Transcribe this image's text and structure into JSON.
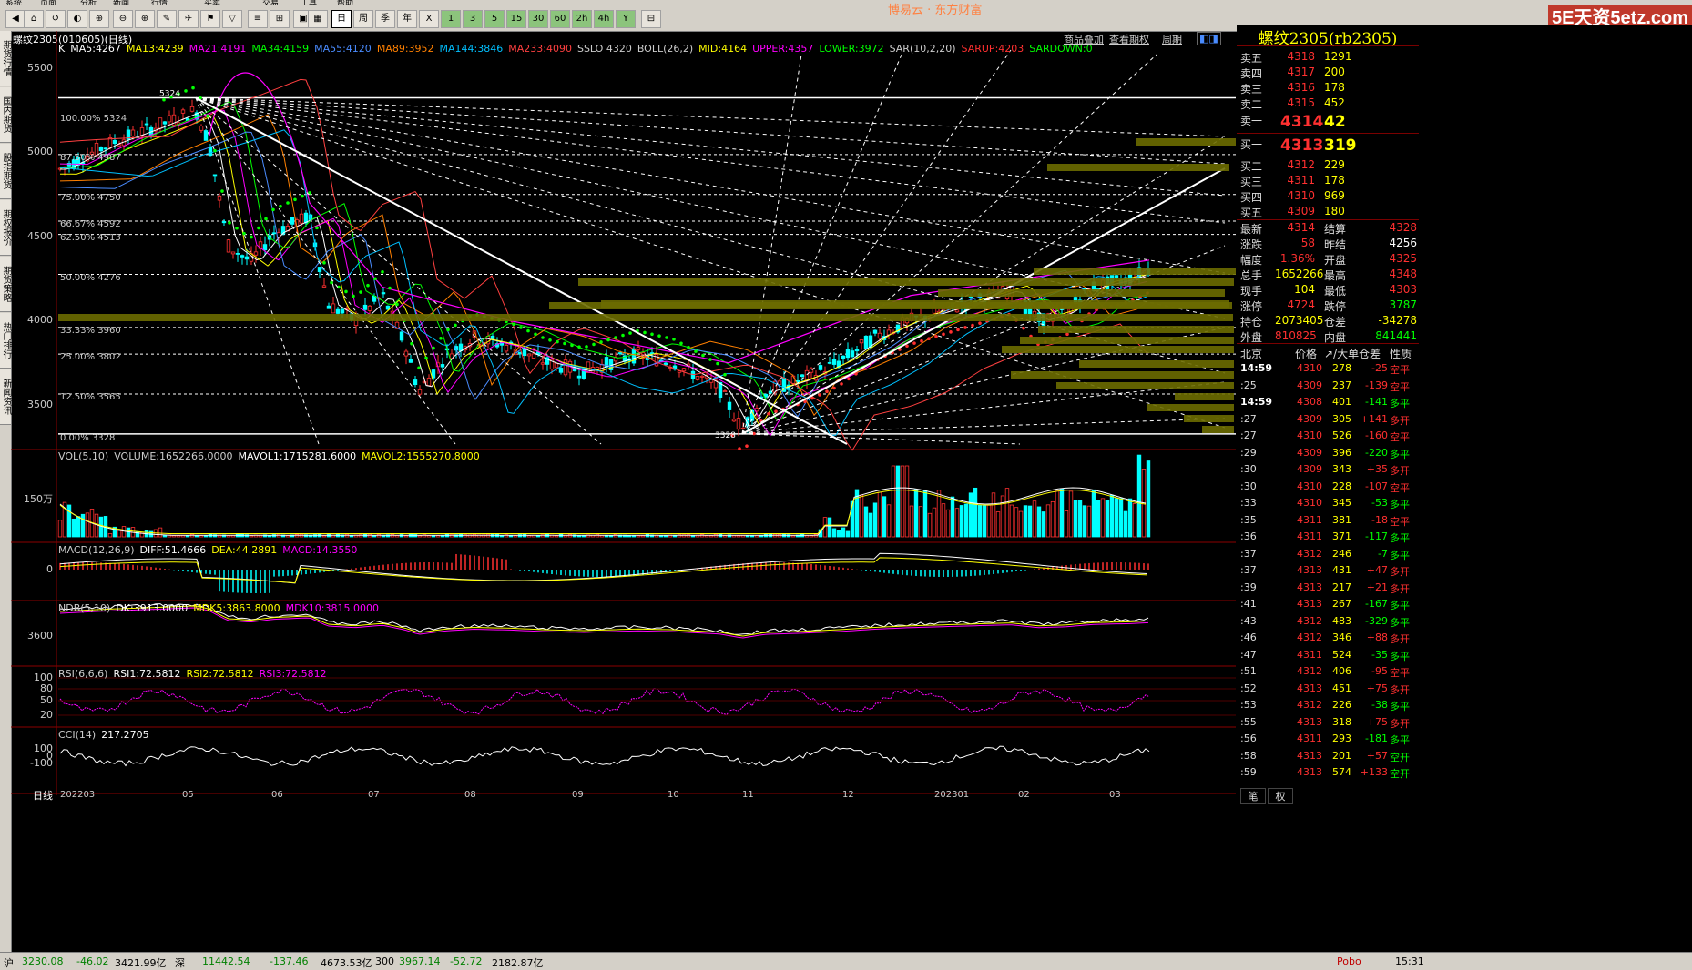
{
  "menu": [
    "系统",
    "页面",
    "分析",
    "新闻",
    "行情",
    "买卖",
    "交易",
    "工具",
    "帮助"
  ],
  "window_title": "博易云 · 东方财富",
  "brand_logo": "5E天资5etz.com",
  "left_tabs": [
    "期货行情",
    "国内期货",
    "股指期货",
    "期权报价",
    "期货策略",
    "热门排行",
    "新闻资讯"
  ],
  "toolbar_labels": {
    "day_k": "日",
    "week": "周",
    "month": "季",
    "year": "年"
  },
  "chart": {
    "symbol": "螺纹2305(010605)(日线)",
    "links": [
      "商品叠加",
      "查看期权",
      "周期"
    ],
    "ma_legend": [
      {
        "t": "K",
        "c": "#ffffff"
      },
      {
        "t": "MA5:4267",
        "c": "#ffffff"
      },
      {
        "t": "MA13:4239",
        "c": "#ffff00"
      },
      {
        "t": "MA21:4191",
        "c": "#ff00ff"
      },
      {
        "t": "MA34:4159",
        "c": "#00ff00"
      },
      {
        "t": "MA55:4120",
        "c": "#4a8cff"
      },
      {
        "t": "MA89:3952",
        "c": "#ff8000"
      },
      {
        "t": "MA144:3846",
        "c": "#00c0ff"
      },
      {
        "t": "MA233:4090",
        "c": "#ff4040"
      },
      {
        "t": "SSLO 4320",
        "c": "#cccccc"
      },
      {
        "t": "BOLL(26,2)",
        "c": "#cccccc"
      },
      {
        "t": "MID:4164",
        "c": "#ffff00"
      },
      {
        "t": "UPPER:4357",
        "c": "#ff00ff"
      },
      {
        "t": "LOWER:3972",
        "c": "#00ff00"
      },
      {
        "t": "SAR(10,2,20)",
        "c": "#cccccc"
      },
      {
        "t": "SARUP:4203",
        "c": "#ff3030"
      },
      {
        "t": "SARDOWN:0",
        "c": "#00ff00"
      }
    ],
    "price_axis": [
      "5500",
      "5000",
      "4500",
      "4000",
      "3500"
    ],
    "fib_levels": [
      "100.00% 5324",
      "87.50% 4987",
      "75.00% 4750",
      "66.67% 4592",
      "62.50% 4513",
      "50.00% 4276",
      "33.33% 3960",
      "25.00% 3802",
      "12.50% 3565",
      "0.00% 3328"
    ],
    "high_marker": "5324",
    "low_marker": "3328",
    "vol_legend": [
      {
        "t": "VOL(5,10)",
        "c": "#cccccc"
      },
      {
        "t": "VOLUME:1652266.0000",
        "c": "#cccccc"
      },
      {
        "t": "MAVOL1:1715281.6000",
        "c": "#ffffff"
      },
      {
        "t": "MAVOL2:1555270.8000",
        "c": "#ffff00"
      }
    ],
    "vol_axis": "150万",
    "macd_legend": [
      {
        "t": "MACD(12,26,9)",
        "c": "#cccccc"
      },
      {
        "t": "DIFF:51.4666",
        "c": "#ffffff"
      },
      {
        "t": "DEA:44.2891",
        "c": "#ffff00"
      },
      {
        "t": "MACD:14.3550",
        "c": "#ff00ff"
      }
    ],
    "macd_axis": "0",
    "ndb_legend": [
      {
        "t": "NDB(5,10)",
        "c": "#cccccc"
      },
      {
        "t": "DK:3913.0000",
        "c": "#ffffff"
      },
      {
        "t": "MDK5:3863.8000",
        "c": "#ffff00"
      },
      {
        "t": "MDK10:3815.0000",
        "c": "#ff00ff"
      }
    ],
    "ndb_axis": "3600",
    "rsi_legend": [
      {
        "t": "RSI(6,6,6)",
        "c": "#cccccc"
      },
      {
        "t": "RSI1:72.5812",
        "c": "#ffffff"
      },
      {
        "t": "RSI2:72.5812",
        "c": "#ffff00"
      },
      {
        "t": "RSI3:72.5812",
        "c": "#ff00ff"
      }
    ],
    "rsi_axis": [
      "100",
      "80",
      "50",
      "20"
    ],
    "cci_legend": [
      {
        "t": "CCI(14)",
        "c": "#cccccc"
      },
      {
        "t": "217.2705",
        "c": "#ffffff"
      }
    ],
    "cci_axis": [
      "100",
      "0",
      "-100"
    ],
    "period_label": "日线",
    "x_axis": [
      "202203",
      "05",
      "06",
      "07",
      "08",
      "09",
      "10",
      "11",
      "12",
      "202301",
      "02",
      "03"
    ]
  },
  "quote": {
    "title": "螺纹2305(rb2305)",
    "asks": [
      {
        "label": "卖五",
        "price": "4318",
        "vol": "1291"
      },
      {
        "label": "卖四",
        "price": "4317",
        "vol": "200"
      },
      {
        "label": "卖三",
        "price": "4316",
        "vol": "178"
      },
      {
        "label": "卖二",
        "price": "4315",
        "vol": "452"
      },
      {
        "label": "卖一",
        "price": "4314",
        "vol": "42"
      }
    ],
    "bids": [
      {
        "label": "买一",
        "price": "4313",
        "vol": "319"
      },
      {
        "label": "买二",
        "price": "4312",
        "vol": "229"
      },
      {
        "label": "买三",
        "price": "4311",
        "vol": "178"
      },
      {
        "label": "买四",
        "price": "4310",
        "vol": "969"
      },
      {
        "label": "买五",
        "price": "4309",
        "vol": "180"
      }
    ],
    "stats": [
      {
        "k1": "最新",
        "v1": "4314",
        "c1": "#ff3030",
        "k2": "结算",
        "v2": "4328",
        "c2": "#ff3030"
      },
      {
        "k1": "涨跌",
        "v1": "58",
        "c1": "#ff3030",
        "k2": "昨结",
        "v2": "4256",
        "c2": "#ffffff"
      },
      {
        "k1": "幅度",
        "v1": "1.36%",
        "c1": "#ff3030",
        "k2": "开盘",
        "v2": "4325",
        "c2": "#ff3030"
      },
      {
        "k1": "总手",
        "v1": "1652266",
        "c1": "#ffff00",
        "k2": "最高",
        "v2": "4348",
        "c2": "#ff3030"
      },
      {
        "k1": "现手",
        "v1": "104",
        "c1": "#ffff00",
        "k2": "最低",
        "v2": "4303",
        "c2": "#ff3030"
      },
      {
        "k1": "涨停",
        "v1": "4724",
        "c1": "#ff3030",
        "k2": "跌停",
        "v2": "3787",
        "c2": "#00ff00"
      },
      {
        "k1": "持仓",
        "v1": "2073405",
        "c1": "#ffff00",
        "k2": "仓差",
        "v2": "-34278",
        "c2": "#ffff00"
      },
      {
        "k1": "外盘",
        "v1": "810825",
        "c1": "#ff3030",
        "k2": "内盘",
        "v2": "841441",
        "c2": "#00ff00"
      }
    ],
    "ticks_header": {
      "time": "北京",
      "price": "价格",
      "vol": "↗/大单",
      "oi": "仓差",
      "nature": "性质"
    },
    "ticks": [
      {
        "t": "14:59",
        "p": "4310",
        "v": "278",
        "o": "-25",
        "n": "空平",
        "nc": "#ff3030",
        "oc": "#ff3030"
      },
      {
        "t": ":25",
        "p": "4309",
        "v": "237",
        "o": "-139",
        "n": "空平",
        "nc": "#ff3030",
        "oc": "#ff3030"
      },
      {
        "t": "14:59",
        "p": "4308",
        "v": "401",
        "o": "-141",
        "n": "多平",
        "nc": "#00ff00",
        "oc": "#00ff00"
      },
      {
        "t": ":27",
        "p": "4309",
        "v": "305",
        "o": "+141",
        "n": "多开",
        "nc": "#ff3030",
        "oc": "#ff3030"
      },
      {
        "t": ":27",
        "p": "4310",
        "v": "526",
        "o": "-160",
        "n": "空平",
        "nc": "#ff3030",
        "oc": "#ff3030"
      },
      {
        "t": ":29",
        "p": "4309",
        "v": "396",
        "o": "-220",
        "n": "多平",
        "nc": "#00ff00",
        "oc": "#00ff00"
      },
      {
        "t": ":30",
        "p": "4309",
        "v": "343",
        "o": "+35",
        "n": "多开",
        "nc": "#ff3030",
        "oc": "#ff3030"
      },
      {
        "t": ":30",
        "p": "4310",
        "v": "228",
        "o": "-107",
        "n": "空平",
        "nc": "#ff3030",
        "oc": "#ff3030"
      },
      {
        "t": ":33",
        "p": "4310",
        "v": "345",
        "o": "-53",
        "n": "多平",
        "nc": "#00ff00",
        "oc": "#00ff00"
      },
      {
        "t": ":35",
        "p": "4311",
        "v": "381",
        "o": "-18",
        "n": "空平",
        "nc": "#ff3030",
        "oc": "#ff3030"
      },
      {
        "t": ":36",
        "p": "4311",
        "v": "371",
        "o": "-117",
        "n": "多平",
        "nc": "#00ff00",
        "oc": "#00ff00"
      },
      {
        "t": ":37",
        "p": "4312",
        "v": "246",
        "o": "-7",
        "n": "多平",
        "nc": "#00ff00",
        "oc": "#00ff00"
      },
      {
        "t": ":37",
        "p": "4313",
        "v": "431",
        "o": "+47",
        "n": "多开",
        "nc": "#ff3030",
        "oc": "#ff3030"
      },
      {
        "t": ":39",
        "p": "4313",
        "v": "217",
        "o": "+21",
        "n": "多开",
        "nc": "#ff3030",
        "oc": "#ff3030"
      },
      {
        "t": ":41",
        "p": "4313",
        "v": "267",
        "o": "-167",
        "n": "多平",
        "nc": "#00ff00",
        "oc": "#00ff00"
      },
      {
        "t": ":43",
        "p": "4312",
        "v": "483",
        "o": "-329",
        "n": "多平",
        "nc": "#00ff00",
        "oc": "#00ff00"
      },
      {
        "t": ":46",
        "p": "4312",
        "v": "346",
        "o": "+88",
        "n": "多开",
        "nc": "#ff3030",
        "oc": "#ff3030"
      },
      {
        "t": ":47",
        "p": "4311",
        "v": "524",
        "o": "-35",
        "n": "多平",
        "nc": "#00ff00",
        "oc": "#00ff00"
      },
      {
        "t": ":51",
        "p": "4312",
        "v": "406",
        "o": "-95",
        "n": "空平",
        "nc": "#ff3030",
        "oc": "#ff3030"
      },
      {
        "t": ":52",
        "p": "4313",
        "v": "451",
        "o": "+75",
        "n": "多开",
        "nc": "#ff3030",
        "oc": "#ff3030"
      },
      {
        "t": ":53",
        "p": "4312",
        "v": "226",
        "o": "-38",
        "n": "多平",
        "nc": "#00ff00",
        "oc": "#00ff00"
      },
      {
        "t": ":55",
        "p": "4313",
        "v": "318",
        "o": "+75",
        "n": "多开",
        "nc": "#ff3030",
        "oc": "#ff3030"
      },
      {
        "t": ":56",
        "p": "4311",
        "v": "293",
        "o": "-181",
        "n": "多平",
        "nc": "#00ff00",
        "oc": "#00ff00"
      },
      {
        "t": ":58",
        "p": "4313",
        "v": "201",
        "o": "+57",
        "n": "空开",
        "nc": "#00ff00",
        "oc": "#ff3030"
      },
      {
        "t": ":59",
        "p": "4313",
        "v": "574",
        "o": "+133",
        "n": "空开",
        "nc": "#00ff00",
        "oc": "#ff3030"
      }
    ],
    "tick_tabs": [
      "笔",
      "权"
    ]
  },
  "status": [
    {
      "t": "沪",
      "c": "#000"
    },
    {
      "t": "3230.08",
      "c": "#008000"
    },
    {
      "t": "-46.02",
      "c": "#008000"
    },
    {
      "t": "3421.99亿",
      "c": "#000"
    },
    {
      "t": "深",
      "c": "#000"
    },
    {
      "t": "11442.54",
      "c": "#008000"
    },
    {
      "t": "-137.46",
      "c": "#008000"
    },
    {
      "t": "4673.53亿",
      "c": "#000"
    },
    {
      "t": "300",
      "c": "#000"
    },
    {
      "t": "3967.14",
      "c": "#008000"
    },
    {
      "t": "-52.72",
      "c": "#008000"
    },
    {
      "t": "2182.87亿",
      "c": "#000"
    },
    {
      "t": "Pobo",
      "c": "#c00000"
    },
    {
      "t": "15:31",
      "c": "#000"
    }
  ]
}
